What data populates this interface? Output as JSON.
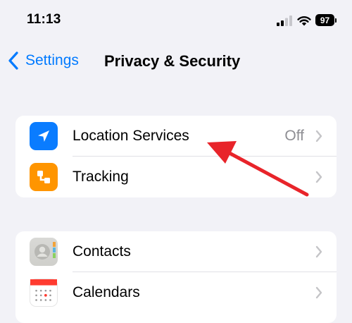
{
  "status_bar": {
    "time": "11:13",
    "battery_level": "97"
  },
  "nav": {
    "back_label": "Settings",
    "title": "Privacy & Security"
  },
  "groups": [
    {
      "rows": [
        {
          "label": "Location Services",
          "value": "Off",
          "icon": "location-arrow-icon",
          "icon_color": "#0a7cff"
        },
        {
          "label": "Tracking",
          "value": "",
          "icon": "tracking-icon",
          "icon_color": "#ff9500"
        }
      ]
    },
    {
      "rows": [
        {
          "label": "Contacts",
          "value": "",
          "icon": "contacts-icon",
          "icon_color": "#d4d4d0"
        },
        {
          "label": "Calendars",
          "value": "",
          "icon": "calendar-icon",
          "icon_color": "#ffffff"
        }
      ]
    }
  ],
  "colors": {
    "accent": "#007aff",
    "background": "#f2f2f7",
    "annotation": "#e8242a"
  }
}
